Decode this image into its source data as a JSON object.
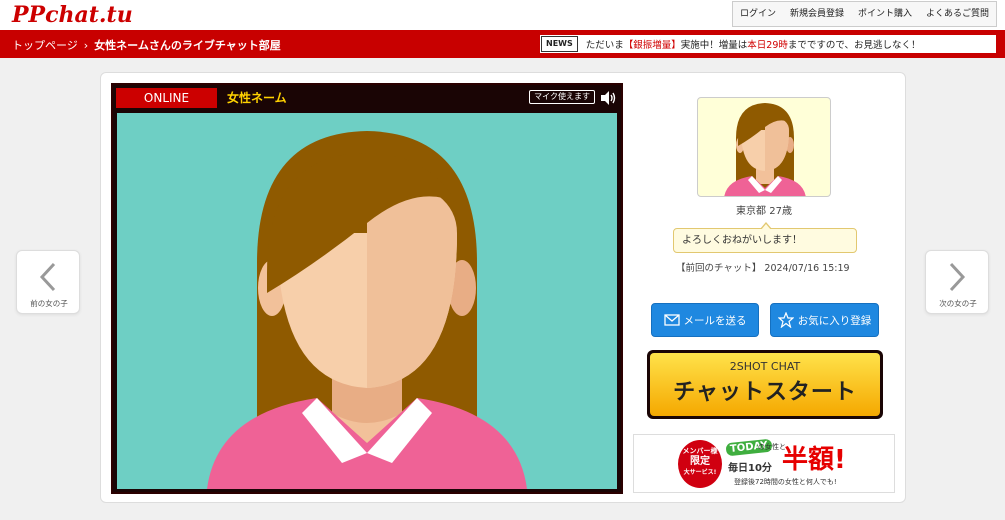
{
  "header": {
    "logo_text": "PPchat.tu",
    "nav": [
      "ログイン",
      "新規会員登録",
      "ポイント購入",
      "よくあるご質問"
    ]
  },
  "breadcrumb": {
    "home": "トップページ",
    "current": "女性ネームさんのライブチャット部屋"
  },
  "news": {
    "label": "NEWS",
    "text_prefix": "ただいま",
    "highlight": "【銀振増量】",
    "text_mid": "実施中！増量は",
    "deadline": "本日29時",
    "text_suffix": "までですので、お見逃しなく！"
  },
  "video": {
    "status": "ONLINE",
    "name": "女性ネーム",
    "mic_label": "マイク使えます"
  },
  "nav_arrows": {
    "prev_label": "前の女の子",
    "next_label": "次の女の子"
  },
  "profile": {
    "location_age": "東京都 27歳",
    "message": "よろしくおねがいします！",
    "last_chat": "【前回のチャット】 2024/07/16 15:19"
  },
  "actions": {
    "mail": "メールを送る",
    "favorite": "お気に入り登録",
    "chat_small": "2SHOT CHAT",
    "chat_big": "チャットスタート"
  },
  "banner": {
    "circle_line1": "メンバー様",
    "circle_line2": "限定",
    "circle_line3": "大サービス!",
    "today": "TODAY",
    "today_suffix": "の女性と",
    "daily": "毎日10分",
    "half": "半額!",
    "note": "登録後72時間の女性と何人でも!"
  },
  "colors": {
    "brand_red": "#c80000",
    "accent_blue": "#1f88e0",
    "chat_yellow": "#ffd200",
    "stage_bg": "#6ecfc4"
  }
}
